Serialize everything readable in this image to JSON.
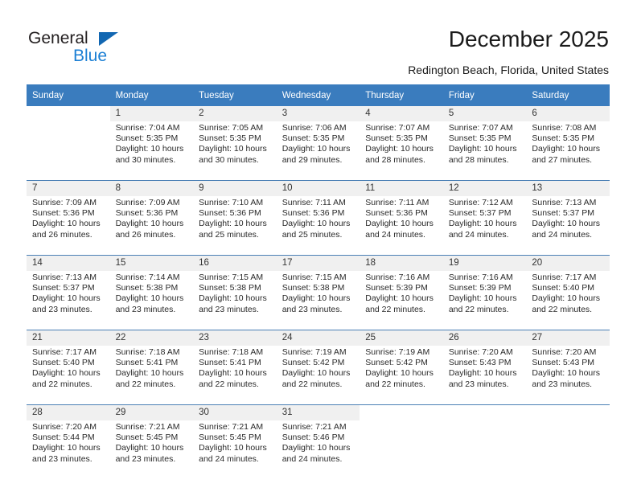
{
  "brand": {
    "name_part1": "General",
    "name_part2": "Blue",
    "triangle_color": "#1267b2",
    "blue_color": "#1b7fd4"
  },
  "header": {
    "title": "December 2025",
    "subtitle": "Redington Beach, Florida, United States"
  },
  "theme": {
    "header_bg": "#3a7cbe",
    "header_text": "#ffffff",
    "date_band_bg": "#f0f0f0",
    "row_separator": "#4a7fb5",
    "body_bg": "#ffffff"
  },
  "calendar": {
    "weekday_headers": [
      "Sunday",
      "Monday",
      "Tuesday",
      "Wednesday",
      "Thursday",
      "Friday",
      "Saturday"
    ],
    "weeks": [
      [
        {
          "day": "",
          "lines": []
        },
        {
          "day": "1",
          "lines": [
            "Sunrise: 7:04 AM",
            "Sunset: 5:35 PM",
            "Daylight: 10 hours",
            "and 30 minutes."
          ]
        },
        {
          "day": "2",
          "lines": [
            "Sunrise: 7:05 AM",
            "Sunset: 5:35 PM",
            "Daylight: 10 hours",
            "and 30 minutes."
          ]
        },
        {
          "day": "3",
          "lines": [
            "Sunrise: 7:06 AM",
            "Sunset: 5:35 PM",
            "Daylight: 10 hours",
            "and 29 minutes."
          ]
        },
        {
          "day": "4",
          "lines": [
            "Sunrise: 7:07 AM",
            "Sunset: 5:35 PM",
            "Daylight: 10 hours",
            "and 28 minutes."
          ]
        },
        {
          "day": "5",
          "lines": [
            "Sunrise: 7:07 AM",
            "Sunset: 5:35 PM",
            "Daylight: 10 hours",
            "and 28 minutes."
          ]
        },
        {
          "day": "6",
          "lines": [
            "Sunrise: 7:08 AM",
            "Sunset: 5:35 PM",
            "Daylight: 10 hours",
            "and 27 minutes."
          ]
        }
      ],
      [
        {
          "day": "7",
          "lines": [
            "Sunrise: 7:09 AM",
            "Sunset: 5:36 PM",
            "Daylight: 10 hours",
            "and 26 minutes."
          ]
        },
        {
          "day": "8",
          "lines": [
            "Sunrise: 7:09 AM",
            "Sunset: 5:36 PM",
            "Daylight: 10 hours",
            "and 26 minutes."
          ]
        },
        {
          "day": "9",
          "lines": [
            "Sunrise: 7:10 AM",
            "Sunset: 5:36 PM",
            "Daylight: 10 hours",
            "and 25 minutes."
          ]
        },
        {
          "day": "10",
          "lines": [
            "Sunrise: 7:11 AM",
            "Sunset: 5:36 PM",
            "Daylight: 10 hours",
            "and 25 minutes."
          ]
        },
        {
          "day": "11",
          "lines": [
            "Sunrise: 7:11 AM",
            "Sunset: 5:36 PM",
            "Daylight: 10 hours",
            "and 24 minutes."
          ]
        },
        {
          "day": "12",
          "lines": [
            "Sunrise: 7:12 AM",
            "Sunset: 5:37 PM",
            "Daylight: 10 hours",
            "and 24 minutes."
          ]
        },
        {
          "day": "13",
          "lines": [
            "Sunrise: 7:13 AM",
            "Sunset: 5:37 PM",
            "Daylight: 10 hours",
            "and 24 minutes."
          ]
        }
      ],
      [
        {
          "day": "14",
          "lines": [
            "Sunrise: 7:13 AM",
            "Sunset: 5:37 PM",
            "Daylight: 10 hours",
            "and 23 minutes."
          ]
        },
        {
          "day": "15",
          "lines": [
            "Sunrise: 7:14 AM",
            "Sunset: 5:38 PM",
            "Daylight: 10 hours",
            "and 23 minutes."
          ]
        },
        {
          "day": "16",
          "lines": [
            "Sunrise: 7:15 AM",
            "Sunset: 5:38 PM",
            "Daylight: 10 hours",
            "and 23 minutes."
          ]
        },
        {
          "day": "17",
          "lines": [
            "Sunrise: 7:15 AM",
            "Sunset: 5:38 PM",
            "Daylight: 10 hours",
            "and 23 minutes."
          ]
        },
        {
          "day": "18",
          "lines": [
            "Sunrise: 7:16 AM",
            "Sunset: 5:39 PM",
            "Daylight: 10 hours",
            "and 22 minutes."
          ]
        },
        {
          "day": "19",
          "lines": [
            "Sunrise: 7:16 AM",
            "Sunset: 5:39 PM",
            "Daylight: 10 hours",
            "and 22 minutes."
          ]
        },
        {
          "day": "20",
          "lines": [
            "Sunrise: 7:17 AM",
            "Sunset: 5:40 PM",
            "Daylight: 10 hours",
            "and 22 minutes."
          ]
        }
      ],
      [
        {
          "day": "21",
          "lines": [
            "Sunrise: 7:17 AM",
            "Sunset: 5:40 PM",
            "Daylight: 10 hours",
            "and 22 minutes."
          ]
        },
        {
          "day": "22",
          "lines": [
            "Sunrise: 7:18 AM",
            "Sunset: 5:41 PM",
            "Daylight: 10 hours",
            "and 22 minutes."
          ]
        },
        {
          "day": "23",
          "lines": [
            "Sunrise: 7:18 AM",
            "Sunset: 5:41 PM",
            "Daylight: 10 hours",
            "and 22 minutes."
          ]
        },
        {
          "day": "24",
          "lines": [
            "Sunrise: 7:19 AM",
            "Sunset: 5:42 PM",
            "Daylight: 10 hours",
            "and 22 minutes."
          ]
        },
        {
          "day": "25",
          "lines": [
            "Sunrise: 7:19 AM",
            "Sunset: 5:42 PM",
            "Daylight: 10 hours",
            "and 22 minutes."
          ]
        },
        {
          "day": "26",
          "lines": [
            "Sunrise: 7:20 AM",
            "Sunset: 5:43 PM",
            "Daylight: 10 hours",
            "and 23 minutes."
          ]
        },
        {
          "day": "27",
          "lines": [
            "Sunrise: 7:20 AM",
            "Sunset: 5:43 PM",
            "Daylight: 10 hours",
            "and 23 minutes."
          ]
        }
      ],
      [
        {
          "day": "28",
          "lines": [
            "Sunrise: 7:20 AM",
            "Sunset: 5:44 PM",
            "Daylight: 10 hours",
            "and 23 minutes."
          ]
        },
        {
          "day": "29",
          "lines": [
            "Sunrise: 7:21 AM",
            "Sunset: 5:45 PM",
            "Daylight: 10 hours",
            "and 23 minutes."
          ]
        },
        {
          "day": "30",
          "lines": [
            "Sunrise: 7:21 AM",
            "Sunset: 5:45 PM",
            "Daylight: 10 hours",
            "and 24 minutes."
          ]
        },
        {
          "day": "31",
          "lines": [
            "Sunrise: 7:21 AM",
            "Sunset: 5:46 PM",
            "Daylight: 10 hours",
            "and 24 minutes."
          ]
        },
        {
          "day": "",
          "lines": []
        },
        {
          "day": "",
          "lines": []
        },
        {
          "day": "",
          "lines": []
        }
      ]
    ]
  }
}
